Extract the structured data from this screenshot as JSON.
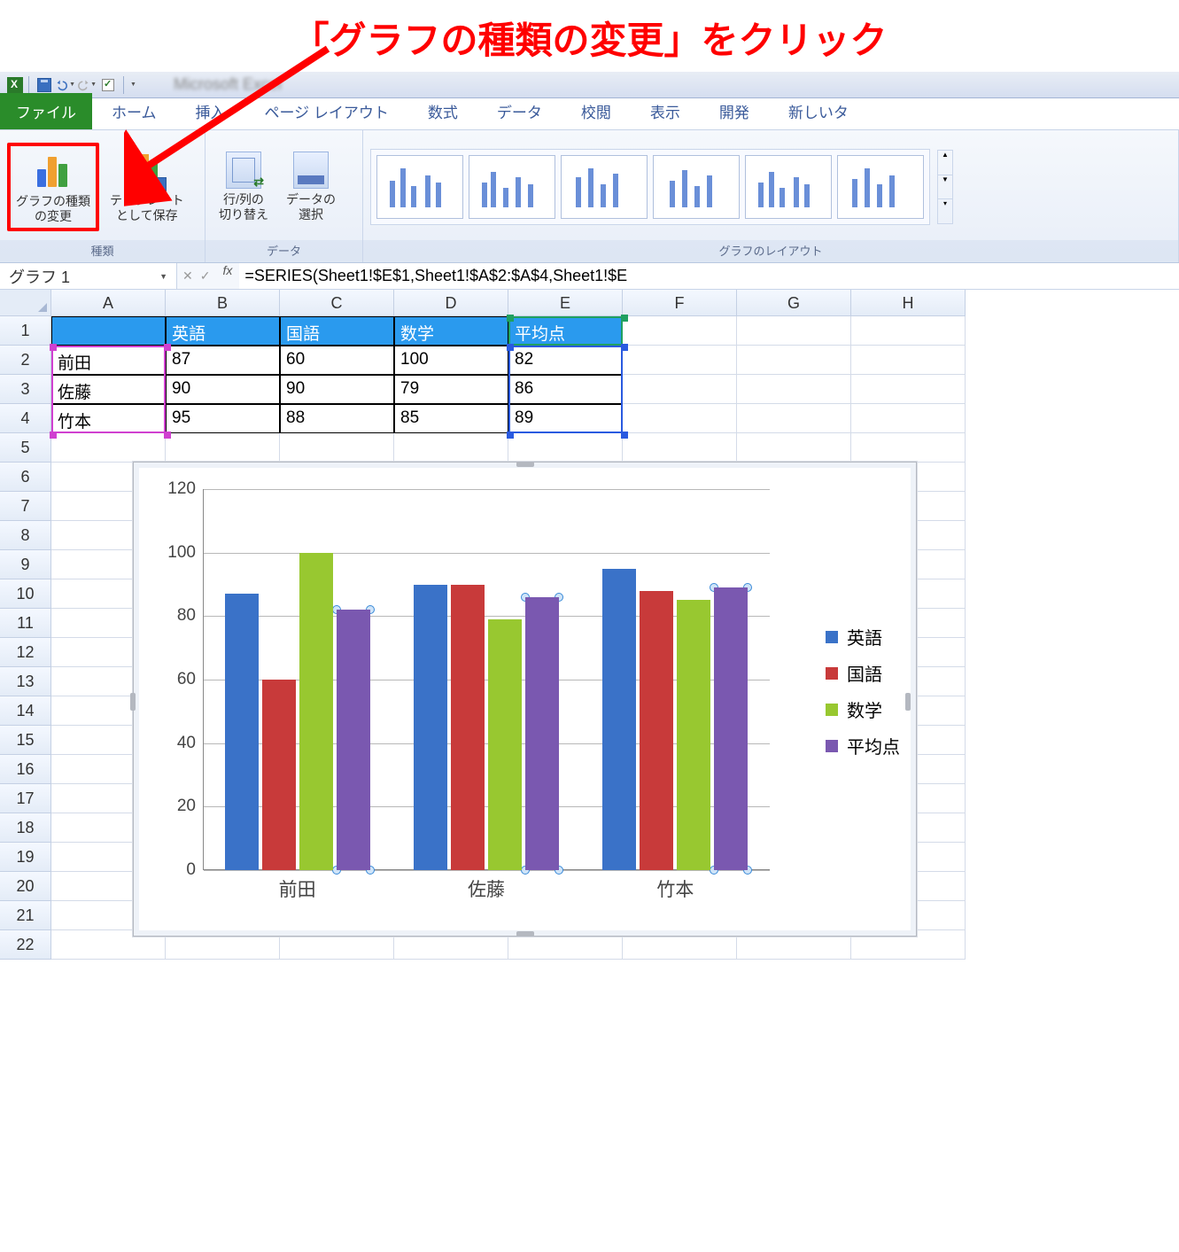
{
  "annotation": "「グラフの種類の変更」をクリック",
  "qat_title_blur": "Microsoft Excel",
  "tabs": {
    "file": "ファイル",
    "home": "ホーム",
    "insert": "挿入",
    "pagelayout": "ページ レイアウト",
    "formulas": "数式",
    "data": "データ",
    "review": "校閲",
    "view": "表示",
    "developer": "開発",
    "new": "新しいタ"
  },
  "ribbon": {
    "group_type_label": "種類",
    "group_data_label": "データ",
    "group_layout_label": "グラフのレイアウト",
    "change_chart_type": "グラフの種類\nの変更",
    "save_template": "テンプレート\nとして保存",
    "switch_row_col": "行/列の\n切り替え",
    "select_data": "データの\n選択"
  },
  "name_box": "グラフ 1",
  "formula": "=SERIES(Sheet1!$E$1,Sheet1!$A$2:$A$4,Sheet1!$E",
  "columns": [
    "A",
    "B",
    "C",
    "D",
    "E",
    "F",
    "G",
    "H"
  ],
  "rows": [
    "1",
    "2",
    "3",
    "4",
    "5",
    "6",
    "7",
    "8",
    "9",
    "10",
    "11",
    "12",
    "13",
    "14",
    "15",
    "16",
    "17",
    "18",
    "19",
    "20",
    "21",
    "22"
  ],
  "table": {
    "headers": [
      "",
      "英語",
      "国語",
      "数学",
      "平均点"
    ],
    "r2": [
      "前田",
      "87",
      "60",
      "100",
      "82"
    ],
    "r3": [
      "佐藤",
      "90",
      "90",
      "79",
      "86"
    ],
    "r4": [
      "竹本",
      "95",
      "88",
      "85",
      "89"
    ]
  },
  "chart_data": {
    "type": "bar",
    "categories": [
      "前田",
      "佐藤",
      "竹本"
    ],
    "series": [
      {
        "name": "英語",
        "values": [
          87,
          90,
          95
        ]
      },
      {
        "name": "国語",
        "values": [
          60,
          90,
          88
        ]
      },
      {
        "name": "数学",
        "values": [
          100,
          79,
          85
        ]
      },
      {
        "name": "平均点",
        "values": [
          82,
          86,
          89
        ]
      }
    ],
    "ylim": [
      0,
      120
    ],
    "yticks": [
      0,
      20,
      40,
      60,
      80,
      100,
      120
    ],
    "selected_series": "平均点",
    "colors": {
      "英語": "#3a72c8",
      "国語": "#c83a3a",
      "数学": "#98c830",
      "平均点": "#7a58b0"
    }
  }
}
